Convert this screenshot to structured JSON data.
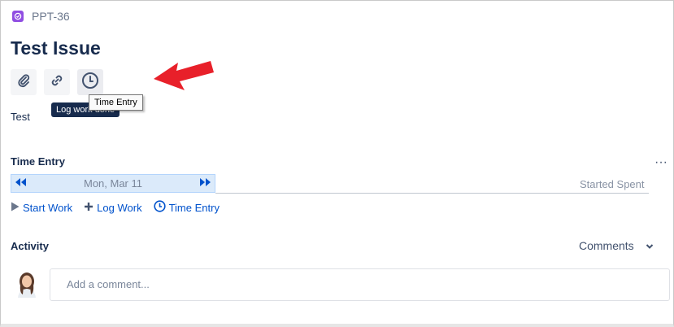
{
  "issue": {
    "key": "PPT-36",
    "title": "Test Issue",
    "description": "Test"
  },
  "toolbar": {
    "attach_icon": "paperclip-icon",
    "link_icon": "link-icon",
    "time_icon": "clock-icon"
  },
  "tooltips": {
    "log_work": "Log work done",
    "time_entry": "Time Entry"
  },
  "time_entry": {
    "title": "Time Entry",
    "date": "Mon, Mar 11",
    "columns": "Started Spent",
    "actions": {
      "start_work": "Start Work",
      "log_work": "Log Work",
      "time_entry": "Time Entry"
    }
  },
  "activity": {
    "title": "Activity",
    "filter": "Comments",
    "comment_placeholder": "Add a comment..."
  },
  "colors": {
    "accent": "#0052cc",
    "annotation": "#e8202a",
    "issue_type": "#904ee2"
  }
}
